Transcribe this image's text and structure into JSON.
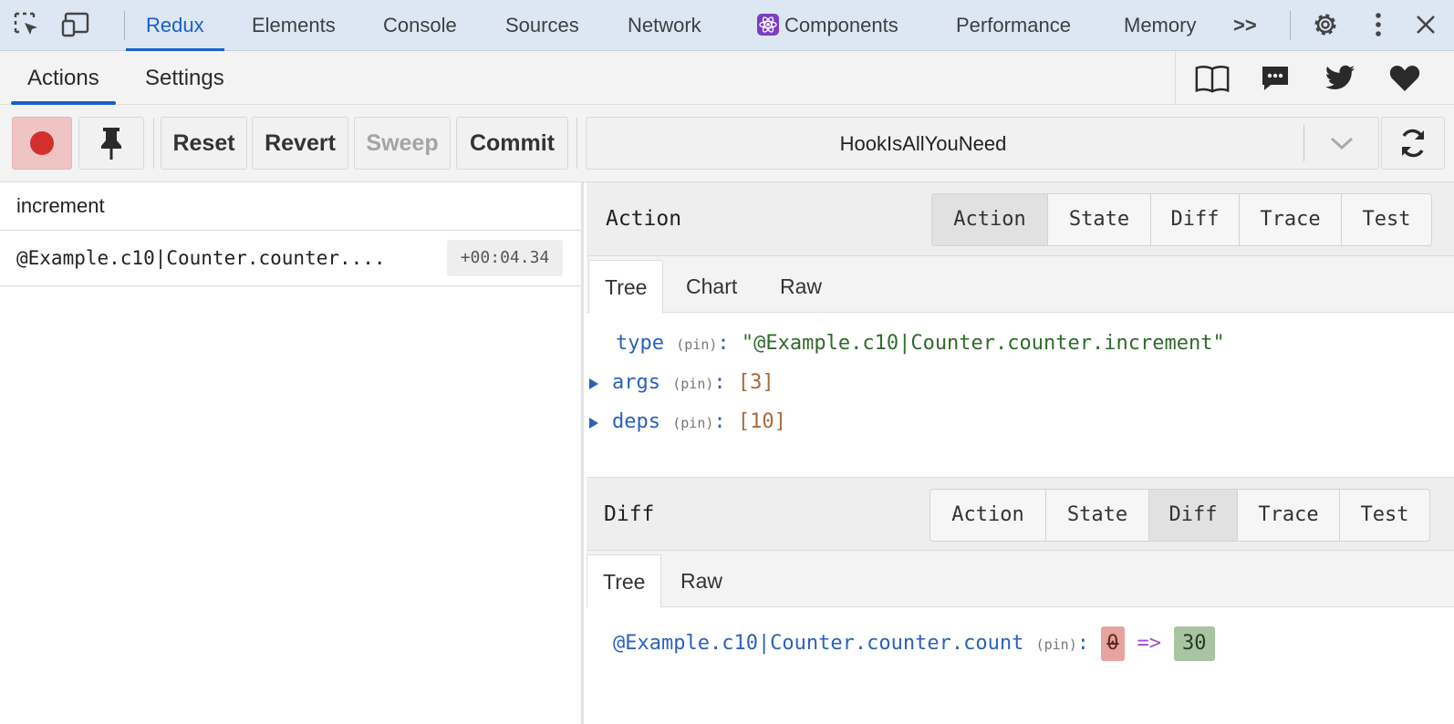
{
  "devtools": {
    "tabs": [
      "Redux",
      "Elements",
      "Console",
      "Sources",
      "Network",
      "Components",
      "Performance",
      "Memory"
    ],
    "more_label": ">>",
    "icons": [
      "inspect-element-icon",
      "device-toolbar-icon",
      "more-tabs-icon",
      "gear-icon",
      "kebab-menu-icon",
      "close-icon"
    ]
  },
  "redux_header": {
    "tabs": [
      "Actions",
      "Settings"
    ],
    "icons": [
      "book-icon",
      "chat-icon",
      "twitter-icon",
      "heart-icon"
    ]
  },
  "toolbar": {
    "reset_label": "Reset",
    "revert_label": "Revert",
    "sweep_label": "Sweep",
    "commit_label": "Commit",
    "instance_name": "HookIsAllYouNeed",
    "icons": [
      "record-icon",
      "pin-icon",
      "chevron-down-icon",
      "sync-icon"
    ]
  },
  "action_list": {
    "filter_value": "increment",
    "items": [
      {
        "name": "@Example.c10|Counter.counter....",
        "time": "+00:04.34"
      }
    ]
  },
  "action_pane": {
    "title": "Action",
    "segments": [
      "Action",
      "State",
      "Diff",
      "Trace",
      "Test"
    ],
    "active_segment": "Action",
    "sub_tabs": [
      "Tree",
      "Chart",
      "Raw"
    ],
    "active_sub_tab": "Tree",
    "pin_label": "(pin)",
    "tree": {
      "type_key": "type",
      "type_value": "\"@Example.c10|Counter.counter.increment\"",
      "args_key": "args",
      "args_value": "[3]",
      "deps_key": "deps",
      "deps_value": "[10]"
    }
  },
  "diff_pane": {
    "title": "Diff",
    "segments": [
      "Action",
      "State",
      "Diff",
      "Trace",
      "Test"
    ],
    "active_segment": "Diff",
    "sub_tabs": [
      "Tree",
      "Raw"
    ],
    "active_sub_tab": "Tree",
    "pin_label": "(pin)",
    "entry": {
      "key": "@Example.c10|Counter.counter.count",
      "old_value": "0",
      "arrow": "=>",
      "new_value": "30"
    }
  },
  "colors": {
    "devtools_bar": "#dde6f3",
    "accent_blue": "#1a5fc9",
    "record_red": "#d32f2f",
    "diff_removed": "#e8a39e",
    "diff_added": "#a9c4a3"
  }
}
